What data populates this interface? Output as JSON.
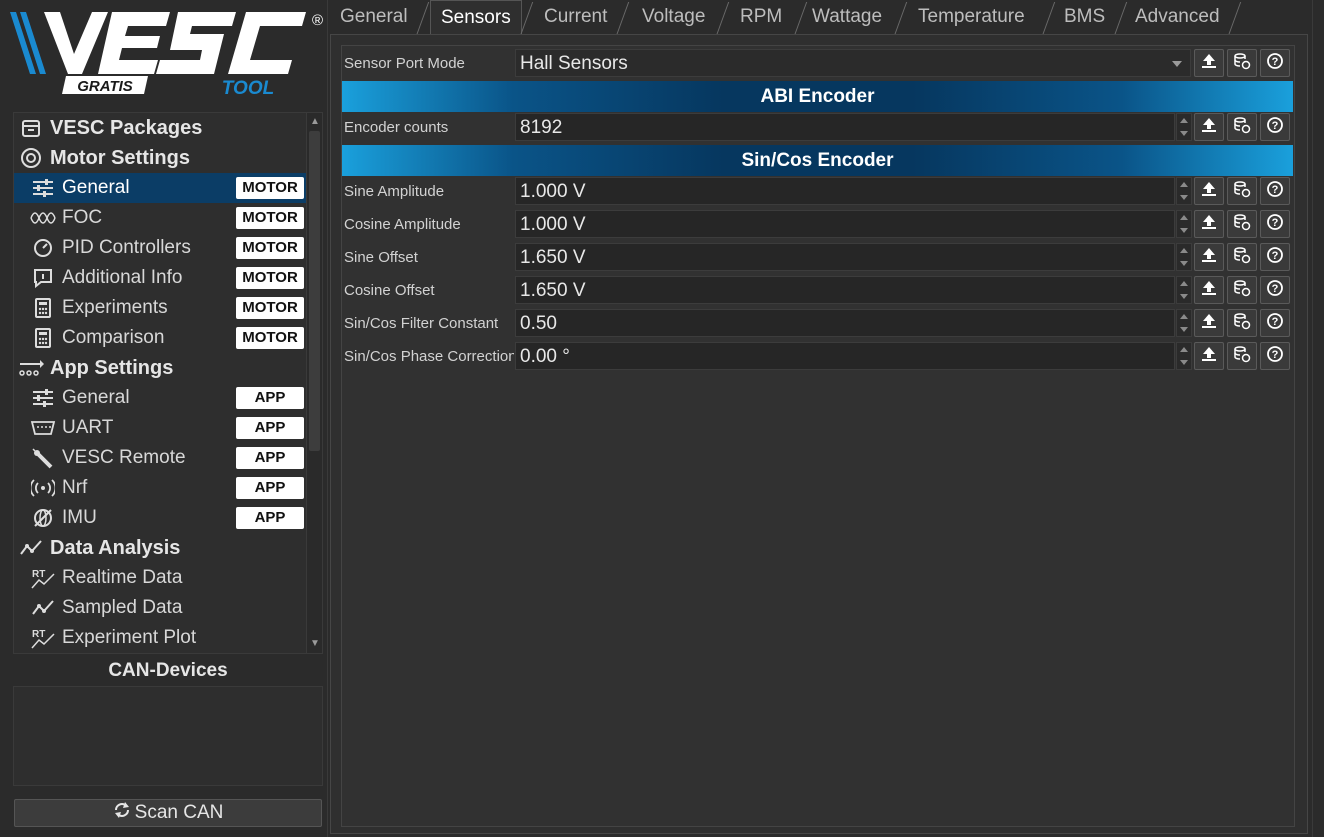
{
  "logo": {
    "brand": "VESC",
    "sub1": "GRATIS",
    "sub2": "TOOL",
    "reg": "®"
  },
  "nav": {
    "items": [
      {
        "type": "cat",
        "label": "VESC Packages",
        "icon": "package-icon"
      },
      {
        "type": "cat",
        "label": "Motor Settings",
        "icon": "motor-icon"
      },
      {
        "type": "item",
        "label": "General",
        "icon": "sliders-icon",
        "badge": "MOTOR",
        "selected": true
      },
      {
        "type": "item",
        "label": "FOC",
        "icon": "foc-icon",
        "badge": "MOTOR"
      },
      {
        "type": "item",
        "label": "PID Controllers",
        "icon": "gauge-icon",
        "badge": "MOTOR"
      },
      {
        "type": "item",
        "label": "Additional Info",
        "icon": "info-icon",
        "badge": "MOTOR"
      },
      {
        "type": "item",
        "label": "Experiments",
        "icon": "calculator-icon",
        "badge": "MOTOR"
      },
      {
        "type": "item",
        "label": "Comparison",
        "icon": "calculator-icon",
        "badge": "MOTOR"
      },
      {
        "type": "cat",
        "label": "App Settings",
        "icon": "app-settings-icon"
      },
      {
        "type": "item",
        "label": "General",
        "icon": "sliders-icon",
        "badge": "APP"
      },
      {
        "type": "item",
        "label": "UART",
        "icon": "uart-icon",
        "badge": "APP"
      },
      {
        "type": "item",
        "label": "VESC Remote",
        "icon": "remote-icon",
        "badge": "APP"
      },
      {
        "type": "item",
        "label": "Nrf",
        "icon": "wireless-icon",
        "badge": "APP"
      },
      {
        "type": "item",
        "label": "IMU",
        "icon": "imu-icon",
        "badge": "APP"
      },
      {
        "type": "cat",
        "label": "Data Analysis",
        "icon": "data-analysis-icon"
      },
      {
        "type": "item",
        "label": "Realtime Data",
        "icon": "realtime-icon"
      },
      {
        "type": "item",
        "label": "Sampled Data",
        "icon": "sampled-icon"
      },
      {
        "type": "item",
        "label": "Experiment Plot",
        "icon": "realtime-icon"
      }
    ]
  },
  "can": {
    "title": "CAN-Devices",
    "scan_label": "Scan CAN"
  },
  "tabs": [
    "General",
    "Sensors",
    "Current",
    "Voltage",
    "RPM",
    "Wattage",
    "Temperature",
    "BMS",
    "Advanced"
  ],
  "active_tab": "Sensors",
  "params": {
    "sensor_port_mode": {
      "label": "Sensor Port Mode",
      "value": "Hall Sensors"
    },
    "abi_title": "ABI Encoder",
    "encoder_counts": {
      "label": "Encoder counts",
      "value": "8192"
    },
    "sincos_title": "Sin/Cos Encoder",
    "sine_amplitude": {
      "label": "Sine Amplitude",
      "value": "1.000 V"
    },
    "cosine_amplitude": {
      "label": "Cosine Amplitude",
      "value": "1.000 V"
    },
    "sine_offset": {
      "label": "Sine Offset",
      "value": "1.650 V"
    },
    "cosine_offset": {
      "label": "Cosine Offset",
      "value": "1.650 V"
    },
    "filter_constant": {
      "label": "Sin/Cos Filter Constant",
      "value": "0.50"
    },
    "phase_correction": {
      "label": "Sin/Cos Phase Correction",
      "value": "0.00 °"
    }
  },
  "colors": {
    "accent": "#1aa0dc",
    "selected": "#0b3d66",
    "background": "#2b2b2b"
  }
}
